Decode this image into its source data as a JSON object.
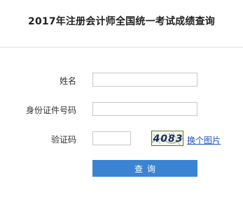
{
  "page": {
    "title": "2017年注册会计师全国统一考试成绩查询"
  },
  "form": {
    "name_label": "姓名",
    "name_value": "",
    "id_label": "身份证件号码",
    "id_value": "",
    "captcha_label": "验证码",
    "captcha_value": "",
    "captcha_image_text": "4083",
    "refresh_captcha_label": "换个图片",
    "submit_label": "查询"
  },
  "colors": {
    "submit_bg": "#3b84d3",
    "link": "#1f52c4",
    "border": "#c8c8c8"
  }
}
